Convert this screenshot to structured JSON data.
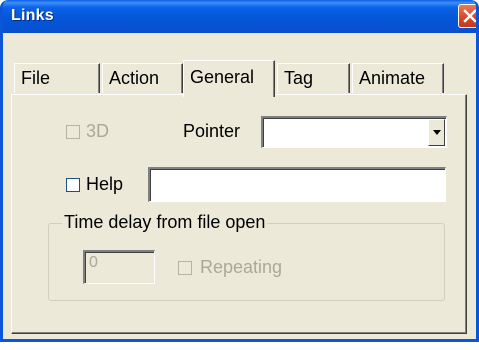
{
  "window": {
    "title": "Links"
  },
  "tabs": [
    {
      "label": "File",
      "active": false
    },
    {
      "label": "Action",
      "active": false
    },
    {
      "label": "General",
      "active": true
    },
    {
      "label": "Tag",
      "active": false
    },
    {
      "label": "Animate",
      "active": false
    }
  ],
  "general": {
    "three_d": {
      "label": "3D",
      "checked": false,
      "enabled": false
    },
    "pointer": {
      "label": "Pointer",
      "value": ""
    },
    "help": {
      "label": "Help",
      "checked": false,
      "enabled": true,
      "value": ""
    },
    "time_delay": {
      "group_label": "Time delay from file open",
      "value": "0",
      "enabled": false,
      "repeating": {
        "label": "Repeating",
        "checked": false,
        "enabled": false
      }
    }
  },
  "icons": {
    "close": "close-icon",
    "dropdown": "chevron-down-icon"
  }
}
